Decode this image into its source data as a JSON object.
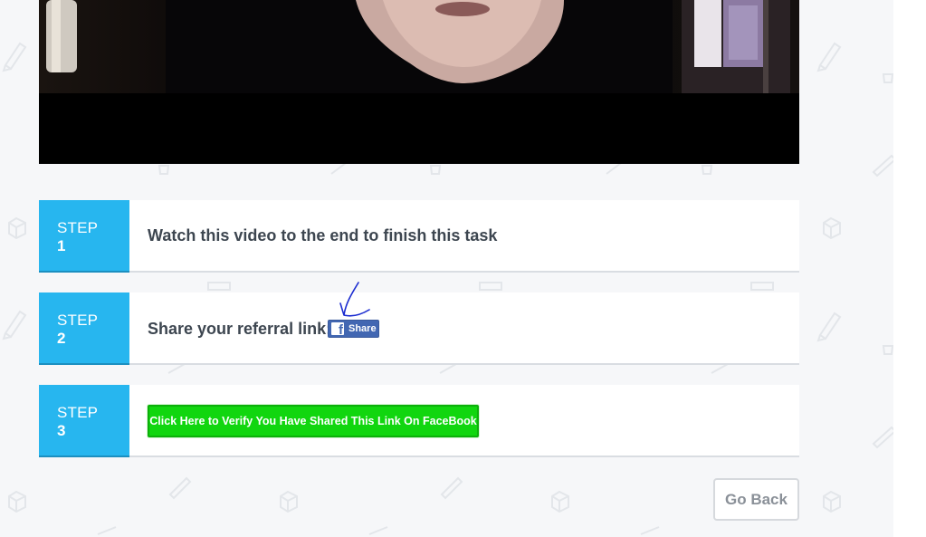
{
  "steps": [
    {
      "word": "STEP",
      "number": "1",
      "text": "Watch this video to the end to finish this task"
    },
    {
      "word": "STEP",
      "number": "2",
      "text": "Share your referral link:"
    },
    {
      "word": "STEP",
      "number": "3"
    }
  ],
  "share_button": {
    "label": "Share",
    "icon": "facebook-icon"
  },
  "verify_button": {
    "label": "Click Here to Verify You Have Shared This Link On FaceBook"
  },
  "go_back_button": {
    "label": "Go Back"
  },
  "colors": {
    "step_badge": "#27b6ef",
    "verify_button": "#11d60f",
    "facebook_blue": "#4267b2",
    "annotation_ink": "#1a2bd0"
  }
}
